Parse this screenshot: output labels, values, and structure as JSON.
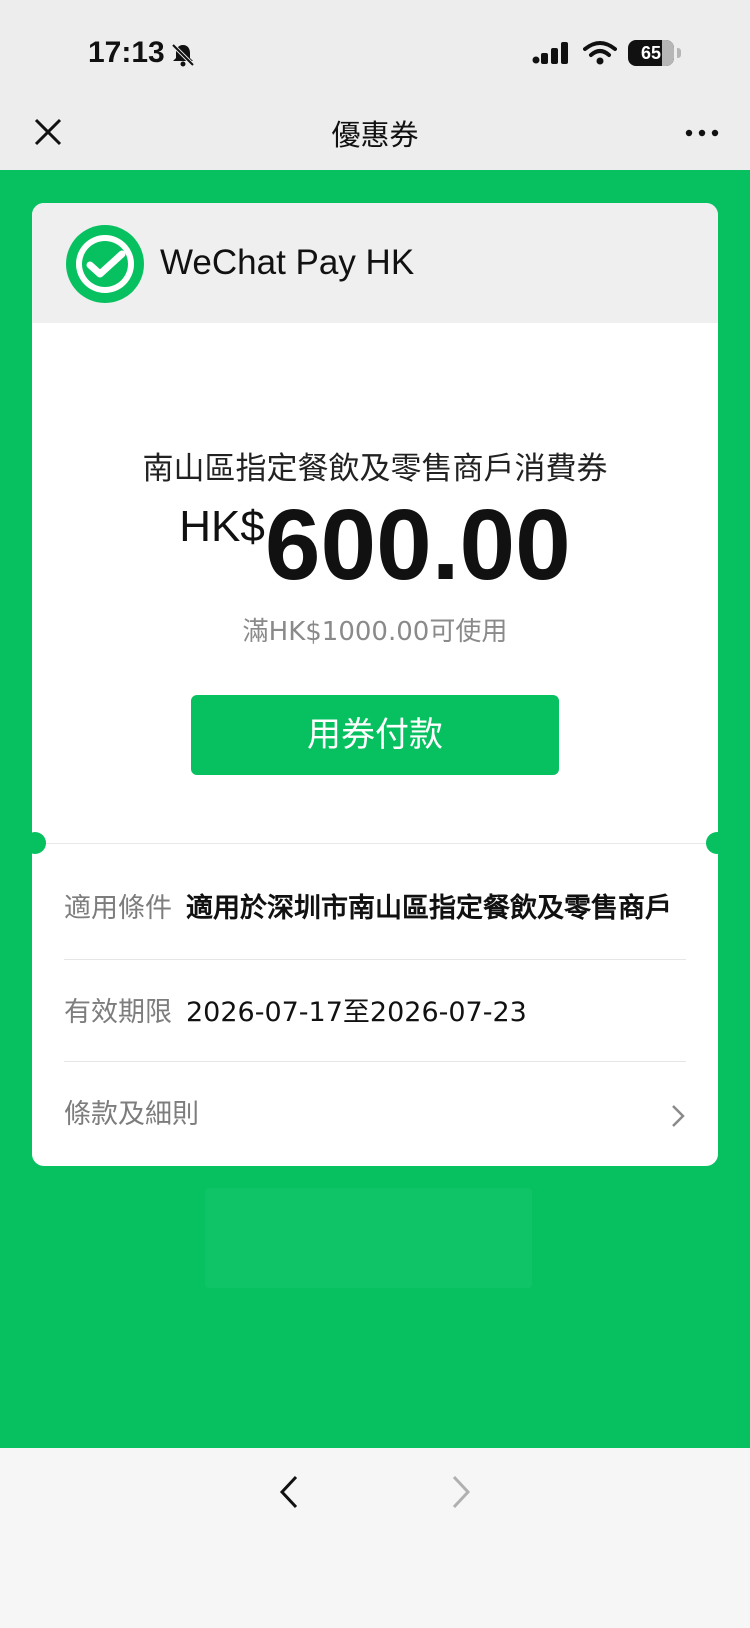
{
  "status_bar": {
    "time": "17:13",
    "battery": "65"
  },
  "nav": {
    "title": "優惠券",
    "close_icon": "close-icon",
    "more_icon": "more-icon"
  },
  "coupon": {
    "brand": "WeChat Pay HK",
    "name": "南山區指定餐飲及零售商戶消費券",
    "currency": "HK$",
    "amount": "600.00",
    "min_spend": "滿HK$1000.00可使用",
    "pay_label": "用券付款"
  },
  "details": {
    "condition_label": "適用條件",
    "condition_value": "適用於深圳市南山區指定餐飲及零售商戶",
    "validity_label": "有效期限",
    "validity_value": "2026-07-17至2026-07-23",
    "terms_label": "條款及細則"
  },
  "colors": {
    "brand_green": "#07c160",
    "top_bar": "#ededed"
  }
}
